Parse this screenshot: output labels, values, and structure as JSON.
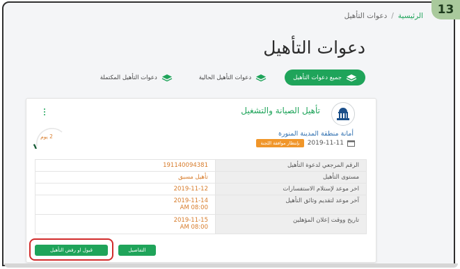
{
  "step_badge": "13",
  "breadcrumb": {
    "home": "الرئيسية",
    "separator": "/",
    "current": "دعوات التأهيل"
  },
  "page_title": "دعوات التأهيل",
  "tabs": [
    {
      "label": "جميع دعوات التأهيل",
      "active": true,
      "icon": "stack-icon"
    },
    {
      "label": "دعوات التأهيل الحالية",
      "active": false,
      "icon": "stack-icon"
    },
    {
      "label": "دعوات التأهيل المكتملة",
      "active": false,
      "icon": "stack-icon"
    }
  ],
  "card": {
    "title": "تأهيل الصيانة والتشغيل",
    "entity": "أمانة منطقة المدينة المنورة",
    "date": "2019-11-11",
    "status": "بإنتظار موافقة اللجنة",
    "days_remaining": "2 يوم",
    "days_progress": 0.3,
    "details": [
      {
        "label": "الرقم المرجعي لدعوة التأهيل",
        "value": "191140094381"
      },
      {
        "label": "مستوى التأهيل",
        "value": "تأهيل مسبق"
      },
      {
        "label": "اخر موعد لإستلام الاستفسارات",
        "value": "2019-11-12"
      },
      {
        "label": "آخر موعد لتقديم وثائق التأهيل",
        "value": "2019-11-14",
        "value2": "AM 08:00"
      },
      {
        "label": "تاريخ ووقت إعلان المؤهلين",
        "value": "2019-11-15",
        "value2": "AM 08:00"
      }
    ],
    "buttons": {
      "details": "التفاصيل",
      "accept_reject": "قبول او رفض التأهيل"
    }
  },
  "colors": {
    "primary": "#1fa45a",
    "accent_orange": "#d77b2a",
    "highlight_red": "#d12b2b"
  }
}
